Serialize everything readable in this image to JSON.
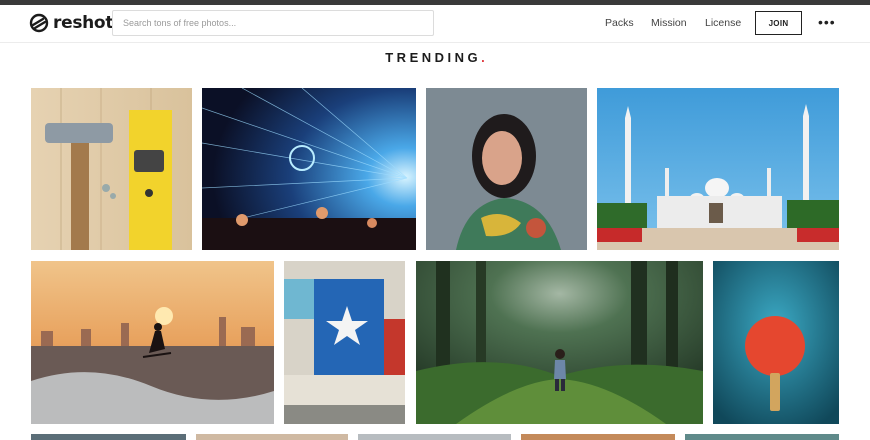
{
  "header": {
    "logo_text": "reshot",
    "search_placeholder": "Search tons of free photos...",
    "nav": [
      "Packs",
      "Mission",
      "License"
    ],
    "join_label": "JOIN",
    "more_label": "•••"
  },
  "section_title": "TRENDING",
  "title_dot": ".",
  "accent_color": "#e0393e",
  "photos": [
    {
      "name": "hammer-level-photo"
    },
    {
      "name": "laser-concert-photo"
    },
    {
      "name": "woman-portrait-photo"
    },
    {
      "name": "mosque-photo"
    },
    {
      "name": "surfer-sunset-photo"
    },
    {
      "name": "texas-flag-wall-photo"
    },
    {
      "name": "forest-girl-photo"
    },
    {
      "name": "ping-pong-paddle-photo"
    }
  ]
}
